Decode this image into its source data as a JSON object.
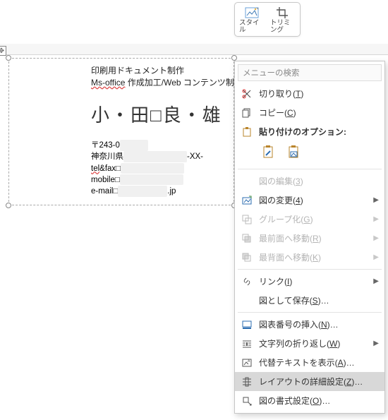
{
  "ribbon": {
    "style_label": "スタイル",
    "trim_label": "トリミング"
  },
  "document": {
    "line1": "印刷用ドキュメント制作",
    "line2_pre": "Ms-office",
    "line2_mid": " 作成加工/Web コンテンツ制作",
    "name": "小・田□良・雄",
    "postal_prefix": "〒243-0",
    "addr_prefix": "神奈川県",
    "addr_suffix": "-XX-",
    "telfax_label": "tel",
    "telfax_label2": "&fax",
    "mobile_label": "mobile",
    "email_label": "e-mail",
    "email_suffix": ".jp"
  },
  "menu": {
    "search_placeholder": "メニューの検索",
    "cut": "切り取り(T)",
    "copy": "コピー(C)",
    "paste_header": "貼り付けのオプション:",
    "edit_fig": "図の編集(3)",
    "change_fig": "図の変更(4)",
    "group": "グループ化(G)",
    "bring_front": "最前面へ移動(R)",
    "send_back": "最背面へ移動(K)",
    "link": "リンク(I)",
    "save_as_pic": "図として保存(S)…",
    "insert_caption": "図表番号の挿入(N)…",
    "text_wrap": "文字列の折り返し(W)",
    "alt_text": "代替テキストを表示(A)…",
    "layout_adv": "レイアウトの詳細設定(Z)…",
    "format_pic": "図の書式設定(O)…"
  },
  "icons": {
    "style": "style-icon",
    "trim": "crop-icon",
    "cut": "scissors-icon",
    "copy": "copy-icon",
    "paste": "clipboard-icon",
    "change": "image-swap-icon",
    "group": "group-icon",
    "front": "bring-front-icon",
    "back": "send-back-icon",
    "link": "link-icon",
    "caption": "caption-icon",
    "wrap": "wrap-text-icon",
    "alt": "alt-text-icon",
    "layout": "layout-icon",
    "format": "format-shape-icon"
  }
}
